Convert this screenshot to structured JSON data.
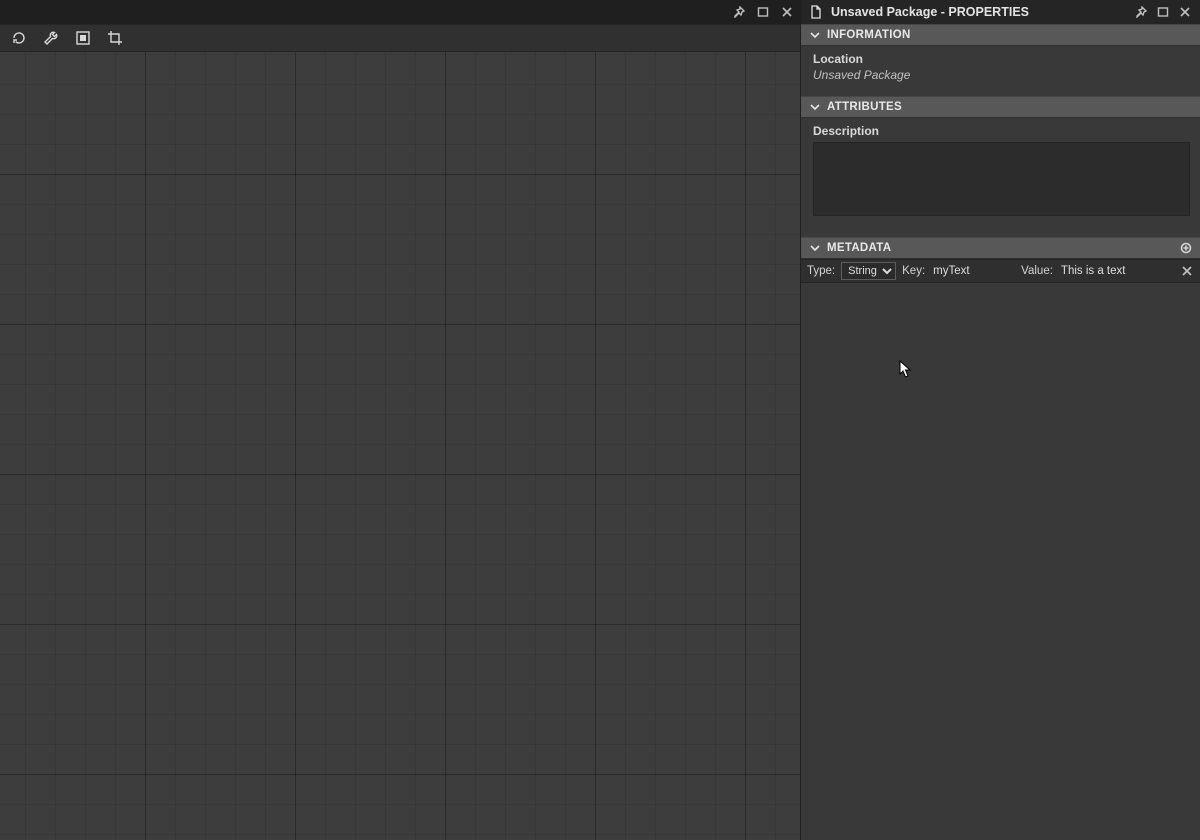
{
  "leftPanel": {
    "toolbar": {
      "tools": [
        {
          "name": "refresh-icon"
        },
        {
          "name": "wrench-icon"
        },
        {
          "name": "output-icon"
        },
        {
          "name": "crop-icon"
        }
      ]
    }
  },
  "rightPanel": {
    "title": "Unsaved Package - PROPERTIES",
    "sections": {
      "information": {
        "header": "INFORMATION",
        "location_label": "Location",
        "location_value": "Unsaved Package"
      },
      "attributes": {
        "header": "ATTRIBUTES",
        "description_label": "Description",
        "description_value": ""
      },
      "metadata": {
        "header": "METADATA",
        "type_label": "Type:",
        "type_value": "String",
        "type_options": [
          "String"
        ],
        "key_label": "Key:",
        "key_value": "myText",
        "value_label": "Value:",
        "value_value": "This is a text"
      }
    }
  }
}
